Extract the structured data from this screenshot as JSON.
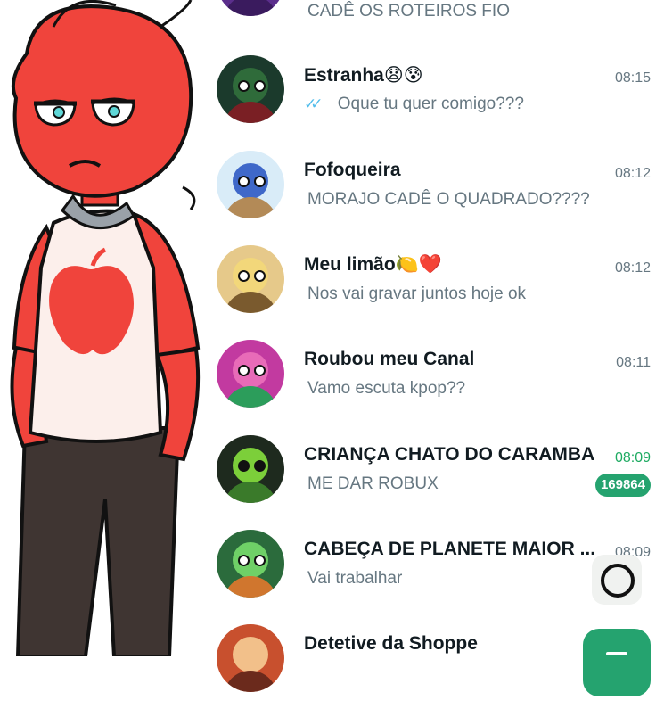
{
  "colors": {
    "name": "#111b21",
    "message": "#667781",
    "unread_accent": "#1daa61",
    "badge": "#25a36f",
    "read_ticks": "#53bdeb",
    "character_skin": "#f0443c"
  },
  "chats": [
    {
      "name": "",
      "time": "",
      "message": "CADÊ OS ROTEIROS FIO",
      "avatar_bg": "#5b2e8c",
      "avatar_head": "#c9a0e8",
      "avatar_body": "#3a1b5e"
    },
    {
      "name": "Estranha😧😰",
      "time": "08:15",
      "message": "Oque tu quer comigo???",
      "read_ticks": "✓✓",
      "avatar_bg": "#1b3a2c",
      "avatar_head": "#2f6b3a",
      "avatar_body": "#7a1f24"
    },
    {
      "name": "Fofoqueira",
      "time": "08:12",
      "message": "MORAJO CADÊ O QUADRADO????",
      "avatar_bg": "#d9ecf8",
      "avatar_head": "#3f68c9",
      "avatar_body": "#b38a57"
    },
    {
      "name": "Meu limão🍋❤️",
      "time": "08:12",
      "message": "Nos vai gravar juntos hoje ok",
      "avatar_bg": "#e6c98a",
      "avatar_head": "#f2d77a",
      "avatar_body": "#7a5a2e"
    },
    {
      "name": "Roubou meu Canal",
      "time": "08:11",
      "message": "Vamo escuta kpop??",
      "avatar_bg": "#c23aa0",
      "avatar_head": "#e86bb8",
      "avatar_body": "#2c9d5b"
    },
    {
      "name": "CRIANÇA CHATO DO CARAMBA",
      "time": "08:09",
      "message": "ME DAR ROBUX",
      "unread_count": "169864",
      "avatar_bg": "#1e2a1e",
      "avatar_head": "#7ccf3a",
      "avatar_body": "#3a7a2a"
    },
    {
      "name": "CABEÇA DE PLANETE MAIOR ...",
      "time": "08:09",
      "message": "Vai trabalhar",
      "avatar_bg": "#2b6b3c",
      "avatar_head": "#6fd067",
      "avatar_body": "#d0762e"
    },
    {
      "name": "Detetive da Shoppe",
      "time": "",
      "message": "",
      "avatar_bg": "#c8502e",
      "avatar_head": "#f2c08a",
      "avatar_body": "#6b2a1c"
    }
  ],
  "icons": {
    "read_ticks": "double-check-icon",
    "record": "circle-record-icon",
    "new_chat": "new-chat-icon"
  }
}
